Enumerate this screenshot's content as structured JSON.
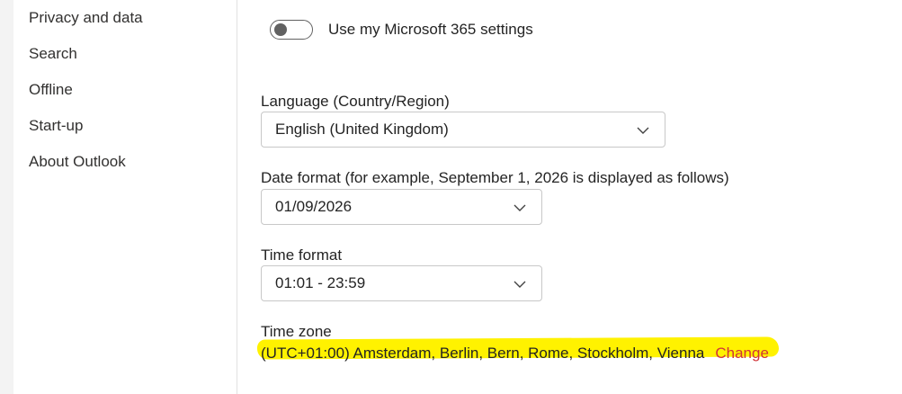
{
  "sidebar": {
    "items": [
      {
        "label": "Privacy and data"
      },
      {
        "label": "Search"
      },
      {
        "label": "Offline"
      },
      {
        "label": "Start-up"
      },
      {
        "label": "About Outlook"
      }
    ]
  },
  "settings": {
    "toggle": {
      "label": "Use my Microsoft 365 settings",
      "state": "off"
    },
    "language": {
      "label": "Language (Country/Region)",
      "value": "English (United Kingdom)"
    },
    "date_format": {
      "label": "Date format (for example, September 1, 2026 is displayed as follows)",
      "value": "01/09/2026"
    },
    "time_format": {
      "label": "Time format",
      "value": "01:01 - 23:59"
    },
    "time_zone": {
      "label": "Time zone",
      "value": "(UTC+01:00) Amsterdam, Berlin, Bern, Rome, Stockholm, Vienna",
      "change_label": "Change"
    }
  },
  "colors": {
    "highlight": "#fff200",
    "change_link": "#d13438"
  }
}
